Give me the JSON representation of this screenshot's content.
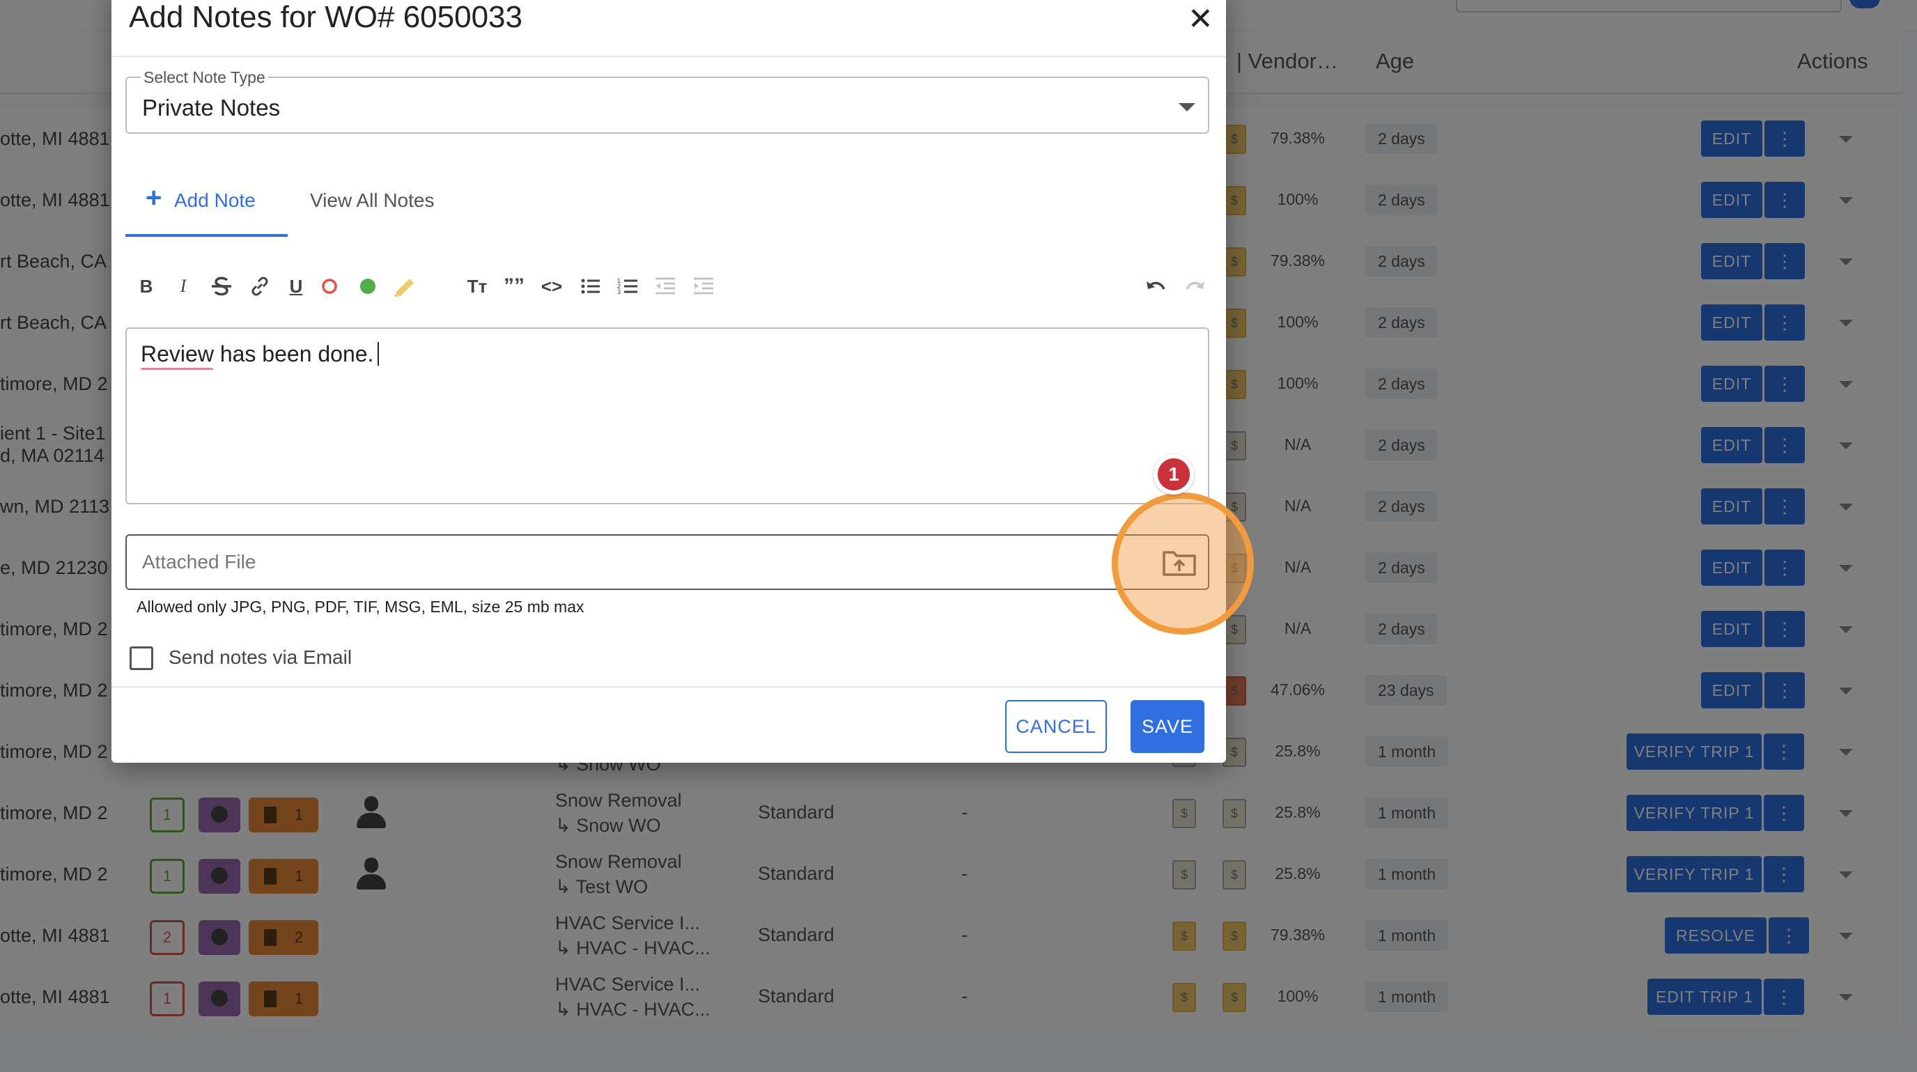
{
  "background_table": {
    "headers": {
      "vendor": "| Vendor…",
      "age": "Age",
      "actions": "Actions"
    },
    "rows": [
      {
        "location": "otte, MI 4881",
        "pct": "79.38%",
        "age": "2 days",
        "action": "EDIT"
      },
      {
        "location": "otte, MI 4881",
        "pct": "100%",
        "age": "2 days",
        "action": "EDIT"
      },
      {
        "location": "rt Beach, CA",
        "pct": "79.38%",
        "age": "2 days",
        "action": "EDIT"
      },
      {
        "location": "rt Beach, CA",
        "pct": "100%",
        "age": "2 days",
        "action": "EDIT"
      },
      {
        "location": "timore, MD 2",
        "pct": "100%",
        "age": "2 days",
        "action": "EDIT"
      },
      {
        "location": "ient 1 - Site1",
        "location2": "d, MA 02114",
        "pct": "N/A",
        "age": "2 days",
        "action": "EDIT"
      },
      {
        "location": "wn, MD 2113",
        "pct": "N/A",
        "age": "2 days",
        "action": "EDIT"
      },
      {
        "location": "e, MD 21230",
        "pct": "N/A",
        "age": "2 days",
        "action": "EDIT"
      },
      {
        "location": "timore, MD 2",
        "pct": "N/A",
        "age": "2 days",
        "action": "EDIT"
      },
      {
        "location": "timore, MD 2",
        "pct": "47.06%",
        "age": "23 days",
        "action": "EDIT"
      },
      {
        "location": "timore, MD 2",
        "pct": "25.8%",
        "age": "1 month",
        "action": "VERIFY TRIP 1",
        "svc2": "↳ Snow WO"
      },
      {
        "location": "timore, MD 2",
        "pct": "25.8%",
        "age": "1 month",
        "action": "VERIFY TRIP 1",
        "badge": "1",
        "badge_color": "#5fa83a",
        "file_count": "1",
        "svc1": "Snow Removal",
        "svc2": "↳ Snow WO",
        "priority": "Standard",
        "dash": "-"
      },
      {
        "location": "timore, MD 2",
        "pct": "25.8%",
        "age": "1 month",
        "action": "VERIFY TRIP 1",
        "badge": "1",
        "badge_color": "#5fa83a",
        "file_count": "1",
        "svc1": "Snow Removal",
        "svc2": "↳ Test WO",
        "priority": "Standard",
        "dash": "-"
      },
      {
        "location": "otte, MI 4881",
        "pct": "79.38%",
        "age": "1 month",
        "action": "RESOLVE",
        "badge": "2",
        "badge_color": "#d8524a",
        "file_count": "2",
        "svc1": "HVAC Service I...",
        "svc2": "↳ HVAC - HVAC...",
        "priority": "Standard",
        "dash": "-"
      },
      {
        "location": "otte, MI 4881",
        "pct": "100%",
        "age": "1 month",
        "action": "EDIT TRIP 1",
        "badge": "1",
        "badge_color": "#d8524a",
        "file_count": "1",
        "svc1": "HVAC Service I...",
        "svc2": "↳ HVAC - HVAC...",
        "priority": "Standard",
        "dash": "-"
      }
    ]
  },
  "modal": {
    "title": "Add Notes for WO# 6050033",
    "close_icon": "close-icon",
    "note_type": {
      "label": "Select Note Type",
      "value": "Private Notes"
    },
    "tabs": [
      {
        "label": "Add Note",
        "active": true
      },
      {
        "label": "View All Notes",
        "active": false
      }
    ],
    "toolbar": {
      "bold": "B",
      "italic": "I",
      "underline": "U",
      "text_size": "Tт",
      "quote": "””",
      "code": "<>"
    },
    "editor": {
      "text": "Review has been done."
    },
    "attach": {
      "placeholder": "Attached File",
      "hint": "Allowed only JPG, PNG, PDF, TIF, MSG, EML, size 25 mb max",
      "upload_icon": "folder-upload-icon"
    },
    "step_badge": "1",
    "send_email_label": "Send notes via Email",
    "cancel_label": "CANCEL",
    "save_label": "SAVE"
  },
  "colors": {
    "accent": "#2f6fe0",
    "highlight": "#f19a3e",
    "badge": "#c9323a"
  }
}
